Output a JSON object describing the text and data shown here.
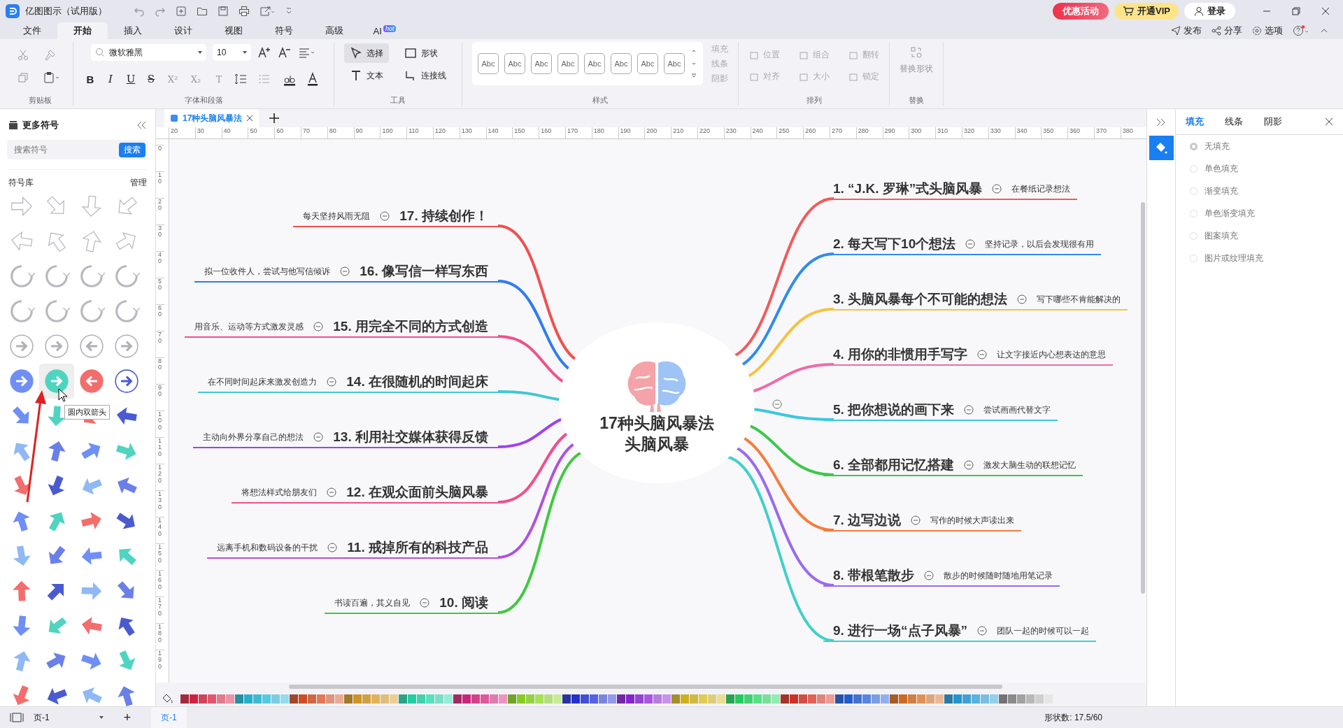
{
  "title_bar": {
    "app_title": "亿图图示（试用版）",
    "promo": "优惠活动",
    "vip": "开通VIP",
    "login": "登录"
  },
  "menu_tabs": [
    {
      "label": "文件",
      "selected": false
    },
    {
      "label": "开始",
      "selected": true
    },
    {
      "label": "插入",
      "selected": false
    },
    {
      "label": "设计",
      "selected": false
    },
    {
      "label": "视图",
      "selected": false
    },
    {
      "label": "符号",
      "selected": false
    },
    {
      "label": "高级",
      "selected": false
    },
    {
      "label": "AI",
      "selected": false,
      "badge": "hot"
    }
  ],
  "top_actions": [
    "发布",
    "分享",
    "选项"
  ],
  "ribbon": {
    "clipboard_label": "剪贴板",
    "font_name": "微软雅黑",
    "font_size": "10",
    "font_label": "字体和段落",
    "format_buttons": [
      {
        "label": "B",
        "kind": "bold"
      },
      {
        "label": "I",
        "kind": "italic"
      },
      {
        "label": "U",
        "kind": "underline"
      },
      {
        "label": "S",
        "kind": "strike"
      },
      {
        "label": "X²",
        "kind": "plain"
      },
      {
        "label": "X₂",
        "kind": "plain"
      },
      {
        "label": "T",
        "kind": "plain"
      }
    ],
    "tools": [
      {
        "label": "选择",
        "selected": true
      },
      {
        "label": "形状",
        "selected": false
      },
      {
        "label": "文本",
        "selected": false
      },
      {
        "label": "连接线",
        "selected": false
      }
    ],
    "tools_label": "工具",
    "styles": [
      "Abc",
      "Abc",
      "Abc",
      "Abc",
      "Abc",
      "Abc",
      "Abc",
      "Abc"
    ],
    "styles_label": "样式",
    "style_options": [
      {
        "label": "填充",
        "disabled": true
      },
      {
        "label": "线条",
        "disabled": true
      },
      {
        "label": "阴影",
        "disabled": true
      }
    ],
    "arrange": [
      {
        "label": "位置",
        "disabled": true
      },
      {
        "label": "组合",
        "disabled": true
      },
      {
        "label": "翻转",
        "disabled": true
      },
      {
        "label": "对齐",
        "disabled": true
      },
      {
        "label": "大小",
        "disabled": true
      },
      {
        "label": "锁定",
        "disabled": true
      }
    ],
    "arrange_label": "排列",
    "replace_button": "替换形状",
    "replace_label": "替换"
  },
  "symbols_panel": {
    "title": "更多符号",
    "search_placeholder": "搜索符号",
    "search_button": "搜索",
    "library_label": "符号库",
    "manage": "管理",
    "tooltip": "圆内双箭头"
  },
  "doc_tab": "17种头脑风暴法",
  "ruler_h": [
    "20",
    "30",
    "40",
    "50",
    "60",
    "70",
    "80",
    "90",
    "100",
    "110",
    "120",
    "130",
    "140",
    "150",
    "160",
    "170",
    "180",
    "190",
    "200",
    "210",
    "220",
    "230",
    "240",
    "250",
    "260",
    "270",
    "280",
    "290",
    "300",
    "310",
    "320",
    "330",
    "340",
    "350",
    "360",
    "370",
    "380"
  ],
  "ruler_v": [
    "0",
    "10",
    "20",
    "30",
    "40",
    "50",
    "60",
    "70",
    "80",
    "90",
    "100",
    "110",
    "120",
    "130",
    "140",
    "150",
    "160",
    "170",
    "180",
    "190"
  ],
  "center": {
    "title": "17种头脑风暴法",
    "subtitle": "头脑风暴"
  },
  "right_branches": [
    {
      "title": "1. “J.K. 罗琳”式头脑风暴",
      "note": "在餐纸记录想法",
      "color": "#f25b5b"
    },
    {
      "title": "2. 每天写下10个想法",
      "note": "坚持记录，以后会发现很有用",
      "color": "#2f8cf0"
    },
    {
      "title": "3. 头脑风暴每个不可能的想法",
      "note": "写下哪些不肯能解决的",
      "color": "#f5c342"
    },
    {
      "title": "4. 用你的非惯用手写字",
      "note": "让文字接近内心想表达的意思",
      "color": "#f06aa8"
    },
    {
      "title": "5. 把你想说的画下来",
      "note": "尝试画画代替文字",
      "color": "#3cc8e0"
    },
    {
      "title": "6. 全部都用记忆搭建",
      "note": "激发大脑生动的联想记忆",
      "color": "#3cc84a"
    },
    {
      "title": "7. 边写边说",
      "note": "写作的时候大声读出来",
      "color": "#f57c3c"
    },
    {
      "title": "8. 带根笔散步",
      "note": "散步的时候随时随地用笔记录",
      "color": "#9a6af0"
    },
    {
      "title": "9. 进行一场“点子风暴”",
      "note": "团队一起的时候可以一起",
      "color": "#40d0c8"
    }
  ],
  "left_branches": [
    {
      "title": "17. 持续创作！",
      "note": "每天坚持风雨无阻",
      "color": "#f05050"
    },
    {
      "title": "16. 像写信一样写东西",
      "note": "拟一位收件人，尝试与他写信倾诉",
      "color": "#2f7cf0"
    },
    {
      "title": "15. 用完全不同的方式创造",
      "note": "用音乐、运动等方式激发灵感",
      "color": "#f0508a"
    },
    {
      "title": "14. 在很随机的时间起床",
      "note": "在不同时间起床来激发创造力",
      "color": "#40c8d0"
    },
    {
      "title": "13. 利用社交媒体获得反馈",
      "note": "主动向外界分享自己的想法",
      "color": "#a040f0"
    },
    {
      "title": "12. 在观众面前头脑风暴",
      "note": "将想法样式给朋友们",
      "color": "#f0508a"
    },
    {
      "title": "11. 戒掉所有的科技产品",
      "note": "远离手机和数码设备的干扰",
      "color": "#b050e0"
    },
    {
      "title": "10. 阅读",
      "note": "书读百遍，其义自见",
      "color": "#40c840"
    }
  ],
  "right_panel": {
    "tabs": [
      {
        "label": "填充",
        "selected": true
      },
      {
        "label": "线条",
        "selected": false
      },
      {
        "label": "阴影",
        "selected": false
      }
    ],
    "options": [
      {
        "label": "无填充",
        "selected": true
      },
      {
        "label": "单色填充",
        "selected": false
      },
      {
        "label": "渐变填充",
        "selected": false
      },
      {
        "label": "单色渐变填充",
        "selected": false
      },
      {
        "label": "图案填充",
        "selected": false
      },
      {
        "label": "图片或纹理填充",
        "selected": false
      }
    ]
  },
  "status_bar": {
    "page_select": "页-1",
    "add_page": "+",
    "page_tab": "页-1",
    "shape_count": "形状数: 17.5/60"
  }
}
